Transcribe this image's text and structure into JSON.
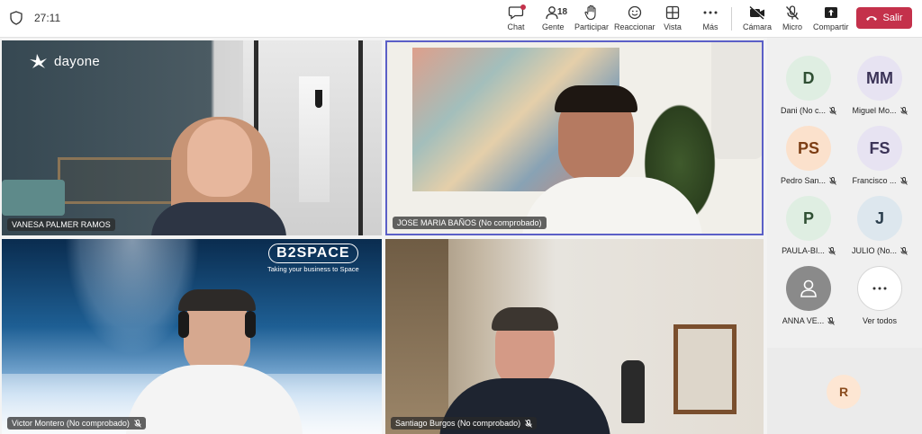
{
  "header": {
    "timer": "27:11",
    "tools": {
      "chat": "Chat",
      "people": "Gente",
      "people_count": "18",
      "raise": "Participar",
      "react": "Reaccionar",
      "view": "Vista",
      "more": "Más",
      "camera": "Cámara",
      "mic": "Micro",
      "share": "Compartir",
      "leave": "Salir"
    }
  },
  "videos": [
    {
      "name": "VANESA PALMER RAMOS",
      "logo": "dayone"
    },
    {
      "name": "JOSE MARIA BAÑOS (No comprobado)"
    },
    {
      "name": "Victor Montero (No comprobado)",
      "logo": "B2SPACE",
      "tagline": "Taking your business to Space"
    },
    {
      "name": "Santiago Burgos (No comprobado)"
    }
  ],
  "participants": [
    {
      "initials": "D",
      "name": "Dani (No c...",
      "color": "#dfeee2",
      "text_color": "#2f4f33"
    },
    {
      "initials": "MM",
      "name": "Miguel Mo...",
      "color": "#e7e3f2",
      "text_color": "#3b3357"
    },
    {
      "initials": "PS",
      "name": "Pedro San...",
      "color": "#fbe1cc",
      "text_color": "#7c3d14"
    },
    {
      "initials": "FS",
      "name": "Francisco ...",
      "color": "#e7e3f2",
      "text_color": "#3b3357"
    },
    {
      "initials": "P",
      "name": "PAULA-BI...",
      "color": "#dfeee2",
      "text_color": "#2f4f33"
    },
    {
      "initials": "J",
      "name": "JULIO (No...",
      "color": "#dde7ee",
      "text_color": "#2c3f4e"
    },
    {
      "initials": "",
      "name": "ANNA VE...",
      "color": "#8a8a8a",
      "text_color": "#ffffff"
    },
    {
      "initials": "",
      "name": "Ver todos",
      "color": "#ffffff",
      "text_color": "#242424"
    }
  ],
  "bottom": {
    "initials": "R"
  }
}
